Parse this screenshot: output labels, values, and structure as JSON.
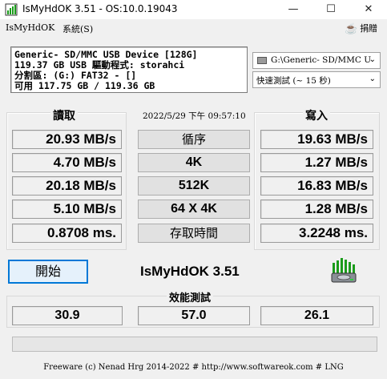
{
  "window": {
    "title": "IsMyHdOK 3.51 - OS:10.0.19043",
    "controls": {
      "minimize": "—",
      "maximize": "☐",
      "close": "✕"
    }
  },
  "menu": {
    "file": "IsMyHdOK",
    "system": "系統(S)",
    "donate": "捐贈"
  },
  "device_info": [
    "Generic- SD/MMC USB Device [128G]",
    "119.37 GB  USB 驅動程式: storahci",
    "分割區: (G:) FAT32 - []",
    "可用 117.75 GB / 119.36 GB"
  ],
  "drive_select": {
    "value": "G:\\Generic- SD/MMC U"
  },
  "mode_select": {
    "value": "快速測試 (~ 15 秒)"
  },
  "headers": {
    "read": "讀取",
    "write": "寫入",
    "timestamp": "2022/5/29 下午 09:57:10"
  },
  "rows": [
    {
      "read": "20.93 MB/s",
      "label": "循序",
      "write": "19.63 MB/s"
    },
    {
      "read": "4.70 MB/s",
      "label": "4K",
      "write": "1.27 MB/s"
    },
    {
      "read": "20.18 MB/s",
      "label": "512K",
      "write": "16.83 MB/s"
    },
    {
      "read": "5.10 MB/s",
      "label": "64 X 4K",
      "write": "1.28 MB/s"
    },
    {
      "read": "0.8708 ms.",
      "label": "存取時間",
      "write": "3.2248 ms."
    }
  ],
  "start_button": "開始",
  "app_name": "IsMyHdOK 3.51",
  "performance": {
    "title": "效能測試",
    "values": [
      "30.9",
      "57.0",
      "26.1"
    ]
  },
  "footer": "Freeware (c) Nenad Hrg 2014-2022 # http://www.softwareok.com     # LNG",
  "colors": {
    "accent": "#0078d7",
    "logo_green": "#1a9c1a"
  }
}
